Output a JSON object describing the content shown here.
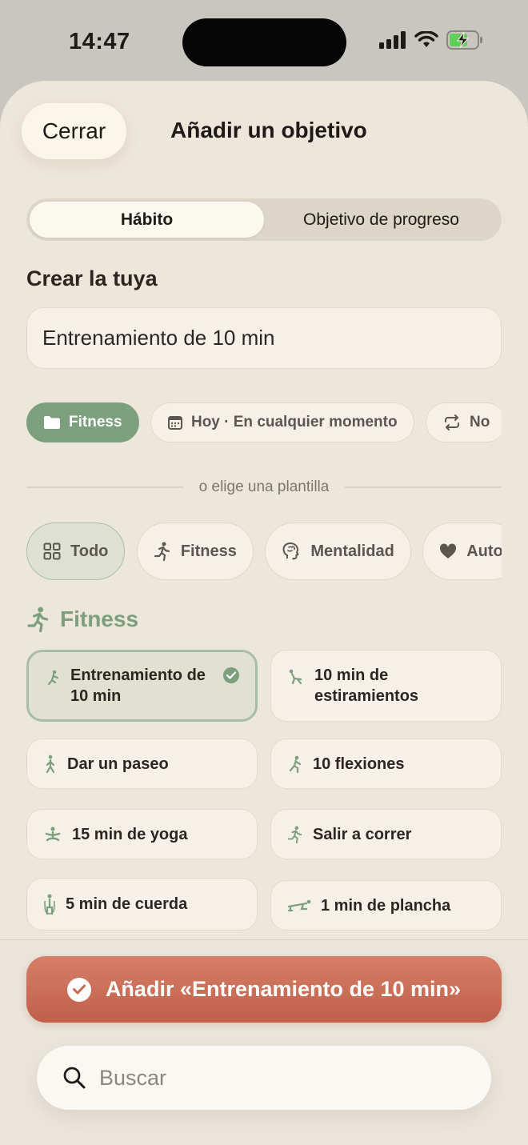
{
  "status_bar": {
    "time": "14:47",
    "battery": "charging"
  },
  "header": {
    "close_label": "Cerrar",
    "title": "Añadir un objetivo"
  },
  "segmented": {
    "habit": "Hábito",
    "progress": "Objetivo de progreso",
    "selected": "Hábito"
  },
  "create_section": {
    "title": "Crear la tuya",
    "name_value": "Entrenamiento de 10 min"
  },
  "option_chips": [
    {
      "label": "Fitness",
      "icon": "folder-icon",
      "style": "green"
    },
    {
      "label": "Hoy · En cualquier momento",
      "icon": "calendar-icon"
    },
    {
      "label": "No",
      "icon": "repeat-icon"
    }
  ],
  "divider_text": "o elige una plantilla",
  "categories": [
    {
      "label": "Todo",
      "icon": "grid-icon",
      "active": true
    },
    {
      "label": "Fitness",
      "icon": "runner-icon"
    },
    {
      "label": "Mentalidad",
      "icon": "brain-icon"
    },
    {
      "label": "Auto",
      "icon": "heart-icon"
    }
  ],
  "fitness_section": {
    "title": "Fitness"
  },
  "templates": [
    {
      "label": "Entrenamiento de 10 min",
      "icon": "workout-icon",
      "selected": true
    },
    {
      "label": "10 min de estiramientos",
      "icon": "stretch-icon"
    },
    {
      "label": "Dar un paseo",
      "icon": "walk-icon"
    },
    {
      "label": "10 flexiones",
      "icon": "pushup-icon"
    },
    {
      "label": "15 min de yoga",
      "icon": "yoga-icon"
    },
    {
      "label": "Salir a correr",
      "icon": "run-icon"
    },
    {
      "label": "5 min de cuerda",
      "icon": "jumprope-icon"
    },
    {
      "label": "1 min de plancha",
      "icon": "plank-icon"
    }
  ],
  "footer": {
    "add_label": "Añadir «Entrenamiento de 10 min»",
    "search_placeholder": "Buscar"
  },
  "colors": {
    "sheet": "#ede6da",
    "accent_green": "#7c9f7d",
    "add_button": "#c96a52"
  }
}
